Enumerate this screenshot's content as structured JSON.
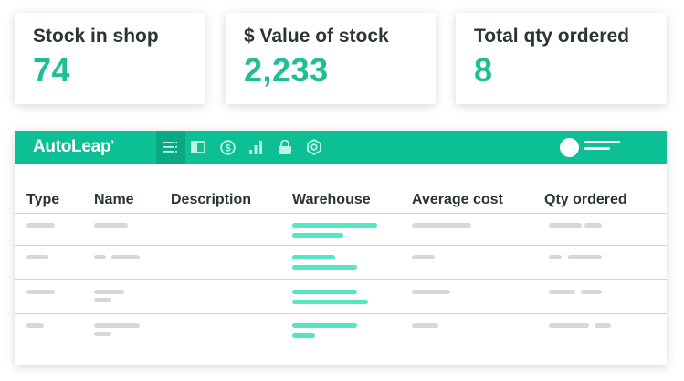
{
  "stats": [
    {
      "label": "Stock in shop",
      "value": "74"
    },
    {
      "label": "$ Value of stock",
      "value": "2,233"
    },
    {
      "label": "Total qty ordered",
      "value": "8"
    }
  ],
  "app": {
    "logo": "AutoLeap",
    "nav_icons": [
      "list-icon",
      "sidebar-panel-icon",
      "dollar-icon",
      "bar-chart-icon",
      "lock-icon",
      "gear-icon"
    ],
    "active_nav": "list-icon"
  },
  "colors": {
    "accent": "#0dbf94",
    "accent_dark": "#0aa983",
    "value_text": "#1fbf95",
    "placeholder_teal": "#54e6c3",
    "placeholder_gray": "#d6d9dc"
  },
  "table": {
    "columns": [
      "Type",
      "Name",
      "Description",
      "Warehouse",
      "Average cost",
      "Qty ordered"
    ]
  }
}
